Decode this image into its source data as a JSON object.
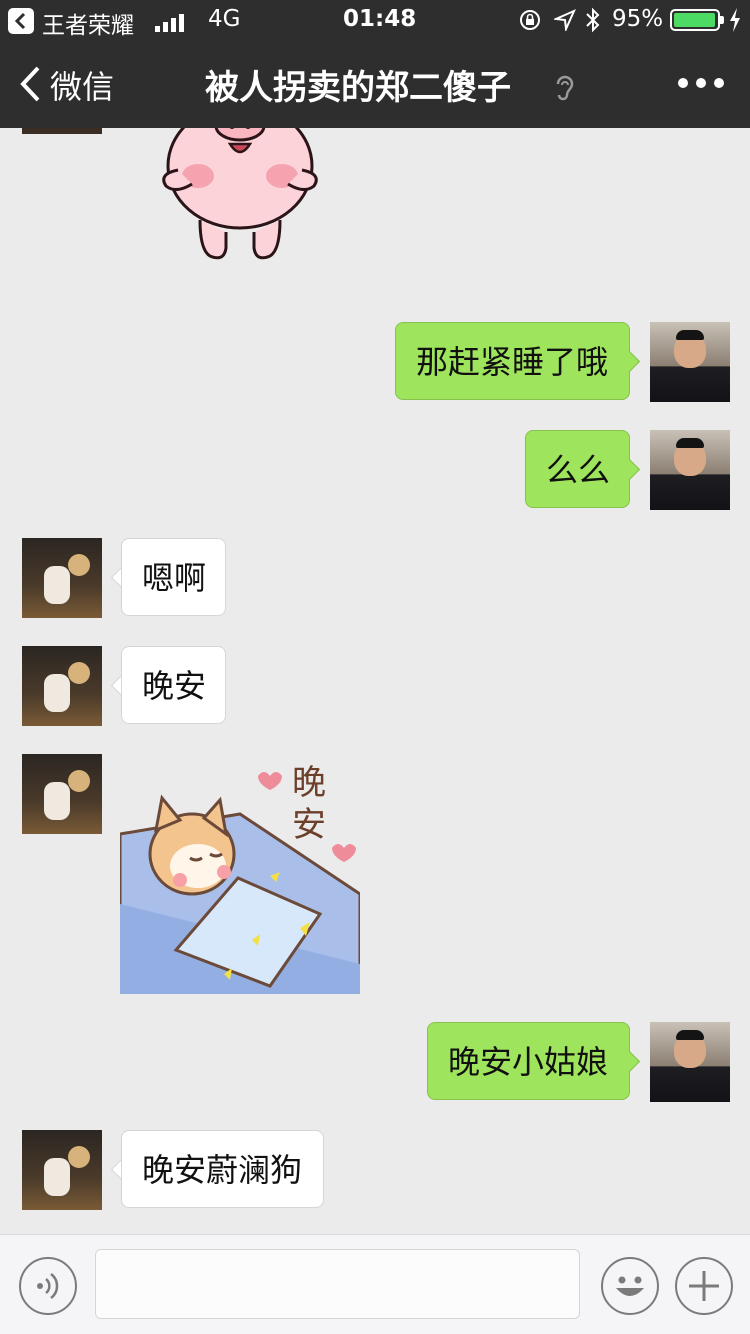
{
  "status_bar": {
    "back_app": "王者荣耀",
    "network": "4G",
    "time": "01:48",
    "battery": "95%"
  },
  "nav": {
    "back_label": "微信",
    "title": "被人拐卖的郑二傻子"
  },
  "messages": [
    {
      "side": "me",
      "text": "那赶紧睡了哦"
    },
    {
      "side": "me",
      "text": "么么"
    },
    {
      "side": "them",
      "text": "嗯啊"
    },
    {
      "side": "them",
      "text": "晚安"
    },
    {
      "side": "them",
      "sticker": "shiba-sleeping-sticker",
      "sticker_text": "晚安"
    },
    {
      "side": "me",
      "text": "晚安小姑娘"
    },
    {
      "side": "them",
      "text": "晚安蔚澜狗"
    }
  ],
  "icons": {
    "pig_sticker": "pig-sticker",
    "voice": "voice-icon",
    "emoji": "emoji-icon",
    "plus": "plus-icon",
    "more": "more-icon",
    "earpiece": "ear-icon"
  },
  "colors": {
    "nav_bg": "#2e2e2e",
    "chat_bg": "#ebebeb",
    "my_bubble": "#9fe45d",
    "their_bubble": "#ffffff",
    "battery_green": "#4cd964"
  },
  "input": {
    "placeholder": ""
  }
}
